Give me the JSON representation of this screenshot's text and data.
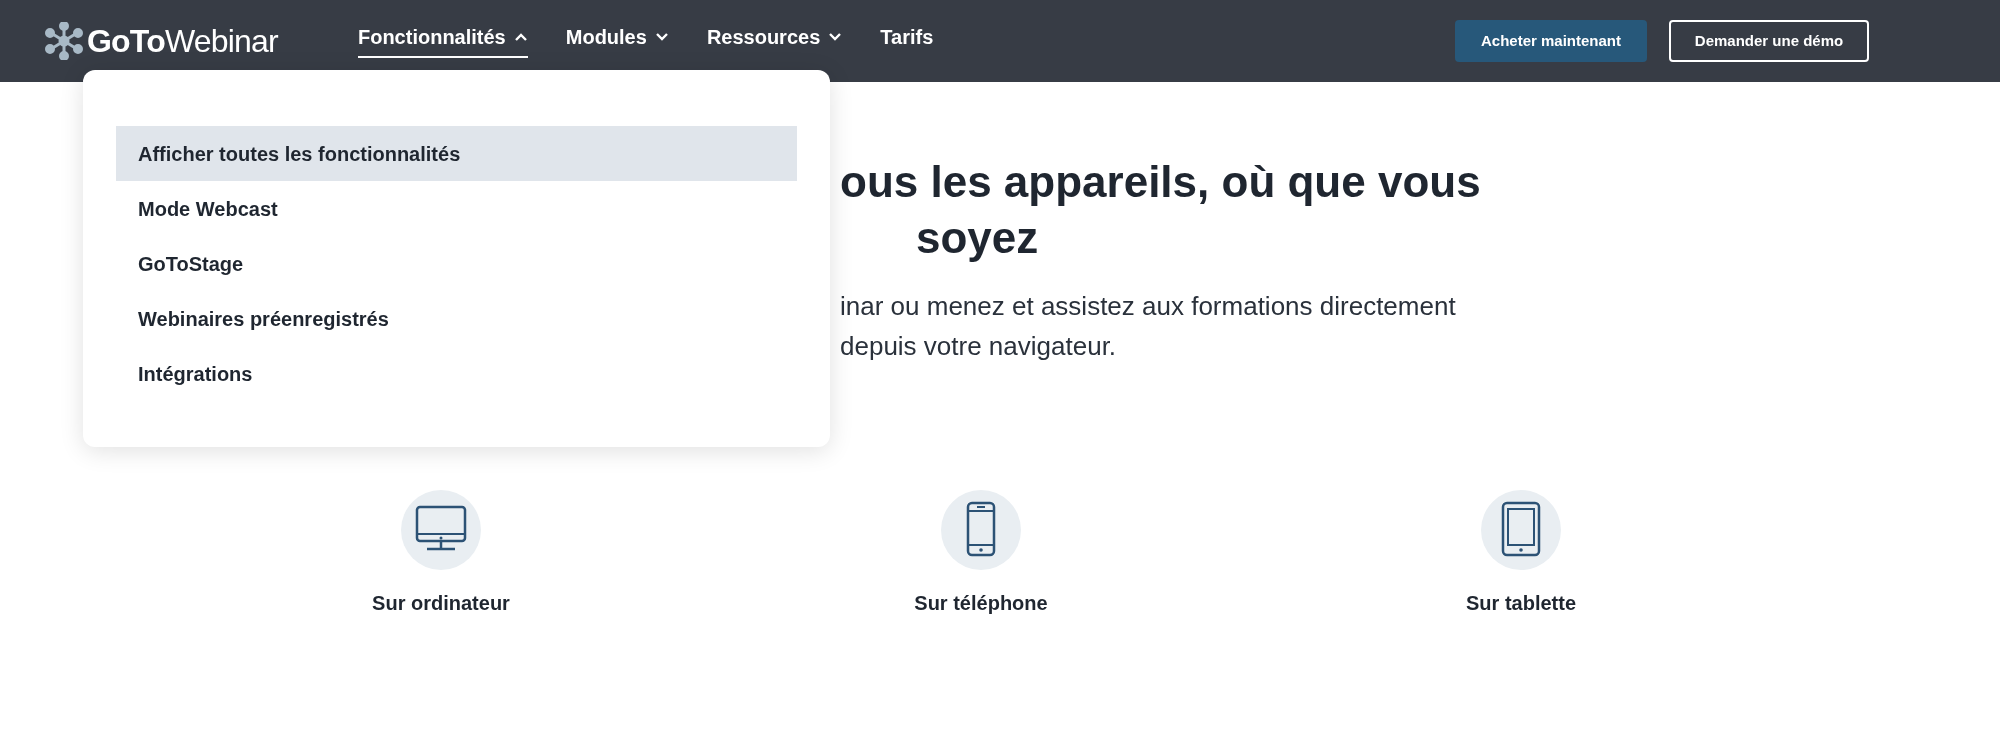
{
  "header": {
    "logo": {
      "part1": "GoTo",
      "part2": "Webinar"
    },
    "nav": [
      {
        "label": "Fonctionnalités",
        "expanded": true,
        "has_caret": true
      },
      {
        "label": "Modules",
        "expanded": false,
        "has_caret": true
      },
      {
        "label": "Ressources",
        "expanded": false,
        "has_caret": true
      },
      {
        "label": "Tarifs",
        "expanded": false,
        "has_caret": false
      }
    ],
    "buttons": [
      {
        "label": "Acheter maintenant",
        "kind": "primary"
      },
      {
        "label": "Demander une démo",
        "kind": "outline"
      }
    ]
  },
  "dropdown": {
    "items": [
      {
        "label": "Afficher toutes les fonctionnalités",
        "selected": true
      },
      {
        "label": "Mode Webcast",
        "selected": false
      },
      {
        "label": "GoToStage",
        "selected": false
      },
      {
        "label": "Webinaires préenregistrés",
        "selected": false
      },
      {
        "label": "Intégrations",
        "selected": false
      }
    ]
  },
  "hero": {
    "heading_lines": [
      "ous les appareils, où que vous",
      "soyez"
    ],
    "text_lines": [
      "inar ou menez et assistez aux formations directement",
      "depuis votre navigateur."
    ]
  },
  "devices": [
    {
      "kind": "desktop",
      "label": "Sur ordinateur"
    },
    {
      "kind": "phone",
      "label": "Sur téléphone"
    },
    {
      "kind": "tablet",
      "label": "Sur tablette"
    }
  ]
}
